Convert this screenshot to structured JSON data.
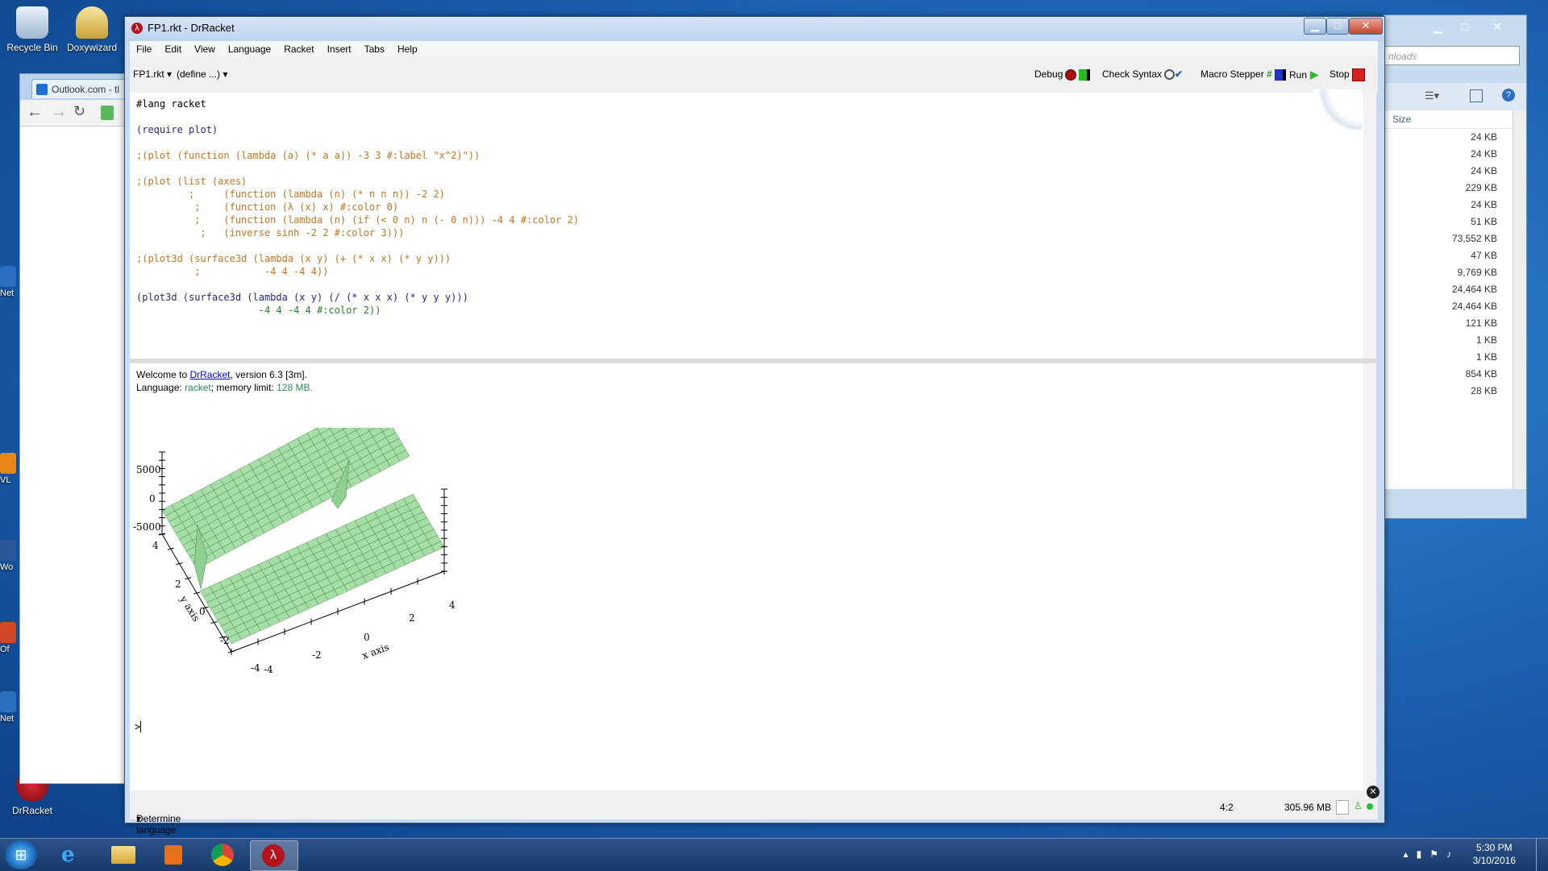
{
  "desktop": {
    "icons": [
      {
        "label": "Recycle Bin"
      },
      {
        "label": "Doxywizard"
      },
      {
        "label": "DrRacket"
      }
    ],
    "edge_labels": [
      "Net",
      "VL",
      "Wo",
      "Of",
      "Net"
    ]
  },
  "browser": {
    "tab_title": "Outlook.com - tl"
  },
  "explorer": {
    "search_placeholder": "nloads",
    "size_header": "Size",
    "sizes": [
      "24 KB",
      "24 KB",
      "24 KB",
      "229 KB",
      "24 KB",
      "51 KB",
      "73,552 KB",
      "47 KB",
      "9,769 KB",
      "24,464 KB",
      "24,464 KB",
      "121 KB",
      "1 KB",
      "1 KB",
      "854 KB",
      "28 KB"
    ]
  },
  "window": {
    "title": "FP1.rkt - DrRacket",
    "menu": [
      "File",
      "Edit",
      "View",
      "Language",
      "Racket",
      "Insert",
      "Tabs",
      "Help"
    ],
    "file_dropdown": "FP1.rkt",
    "define_dropdown": "(define ...)",
    "toolbar": {
      "debug": "Debug",
      "check_syntax": "Check Syntax",
      "macro_stepper": "Macro Stepper",
      "run": "Run",
      "stop": "Stop"
    },
    "code": [
      "#lang racket",
      "",
      "(require plot)",
      "",
      ";(plot (function (lambda (a) (* a a)) -3 3 #:label \"x^2)\"))",
      "",
      ";(plot (list (axes)",
      "         ;     (function (lambda (n) (* n n n)) -2 2)",
      "          ;    (function (λ (x) x) #:color 0)",
      "          ;    (function (lambda (n) (if (< 0 n) n (- 0 n))) -4 4 #:color 2)",
      "           ;   (inverse sinh -2 2 #:color 3)))",
      "",
      ";(plot3d (surface3d (lambda (x y) (+ (* x x) (* y y)))",
      "          ;           -4 4 -4 4))",
      "",
      "(plot3d (surface3d (lambda (x y) (/ (* x x x) (* y y y)))",
      "                     -4 4 -4 4 #:color 2))"
    ],
    "repl": {
      "welcome_prefix": "Welcome to ",
      "welcome_link": "DrRacket",
      "welcome_suffix": ", version 6.3 [3m].",
      "language_prefix": "Language: ",
      "language_name": "racket",
      "language_mid": "; memory limit: ",
      "memory_limit": "128 MB",
      "language_end": ".",
      "prompt": ">"
    },
    "plot": {
      "z_ticks": [
        "5000",
        "0",
        "-5000"
      ],
      "y_ticks": [
        "4",
        "2",
        "0",
        "-2",
        "-4"
      ],
      "x_ticks": [
        "-4",
        "-2",
        "0",
        "2",
        "4"
      ],
      "x_label": "x axis",
      "y_label": "y axis"
    },
    "status": {
      "language": "Determine language from source",
      "position": "4:2",
      "memory": "305.96 MB"
    }
  },
  "taskbar": {
    "time": "5:30 PM",
    "date": "3/10/2016"
  },
  "colors": {
    "surface": "#a6dfa6",
    "surface_grid": "#3b6e3b",
    "comment": "#c2741f"
  }
}
